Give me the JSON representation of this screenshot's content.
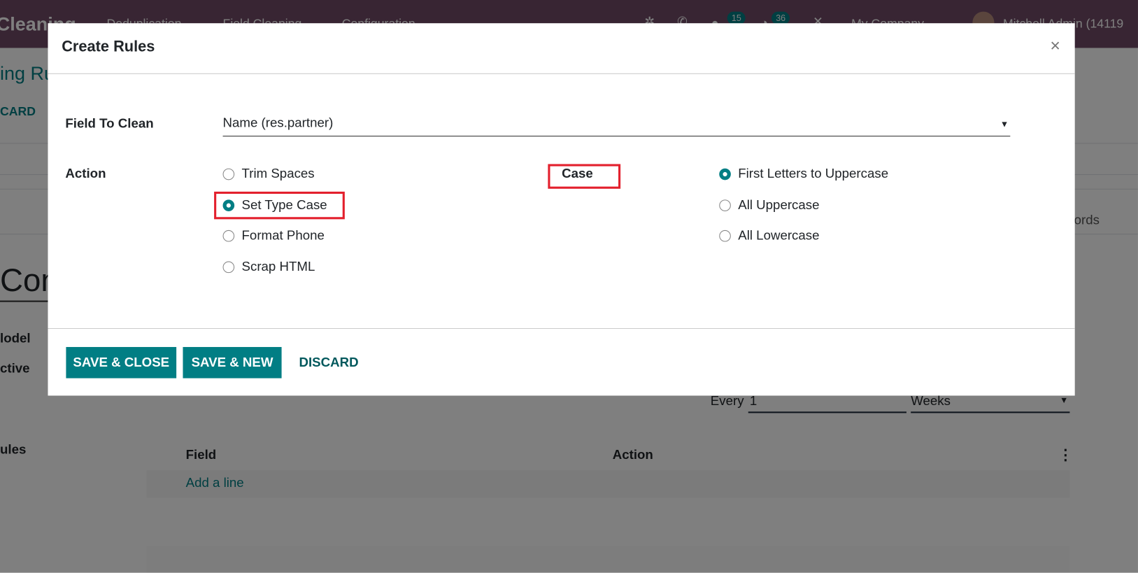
{
  "navbar": {
    "app_name": "Cleaning",
    "menus": [
      "Deduplication",
      "Field Cleaning",
      "Configuration"
    ],
    "messages_count": "15",
    "activities_count": "36",
    "company": "My Company",
    "user": "Mitchell Admin (14119"
  },
  "background": {
    "breadcrumb": "ing Ru",
    "discard": "CARD",
    "smart_button": "ords",
    "record_name": "Con",
    "labels": [
      "lodel",
      "ctive",
      "ules"
    ],
    "every_label": "Every",
    "every_value": "1",
    "period": "Weeks",
    "table_headers": [
      "Field",
      "Action"
    ],
    "add_line": "Add a line"
  },
  "dialog": {
    "title": "Create Rules",
    "field_to_clean_label": "Field To Clean",
    "field_to_clean_value": "Name (res.partner)",
    "action_label": "Action",
    "actions": [
      {
        "label": "Trim Spaces",
        "selected": false
      },
      {
        "label": "Set Type Case",
        "selected": true
      },
      {
        "label": "Format Phone",
        "selected": false
      },
      {
        "label": "Scrap HTML",
        "selected": false
      }
    ],
    "case_label": "Case",
    "cases": [
      {
        "label": "First Letters to Uppercase",
        "selected": true
      },
      {
        "label": "All Uppercase",
        "selected": false
      },
      {
        "label": "All Lowercase",
        "selected": false
      }
    ],
    "save_close": "SAVE & CLOSE",
    "save_new": "SAVE & NEW",
    "discard": "DISCARD"
  },
  "colors": {
    "primary": "#017e84",
    "navbar": "#714b67",
    "highlight": "#e3202d"
  }
}
